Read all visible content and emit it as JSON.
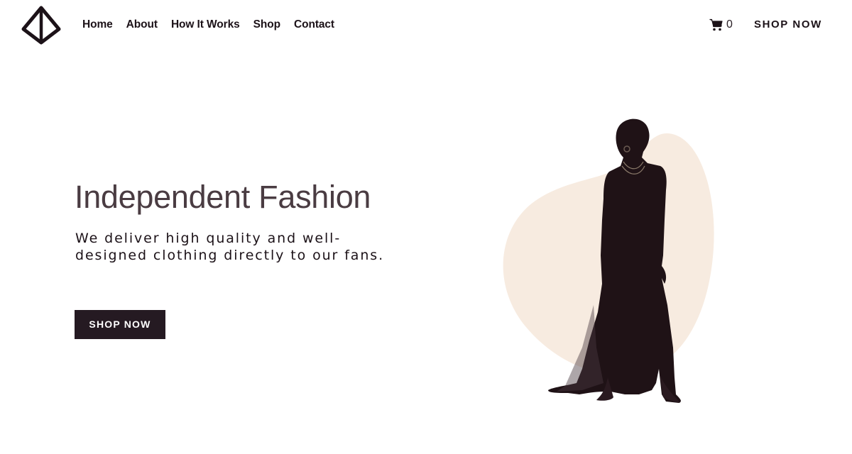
{
  "brand": {
    "logo_icon": "diamond-pyramid-logo-icon",
    "color": "#1c1218"
  },
  "nav": {
    "items": [
      {
        "label": "Home"
      },
      {
        "label": "About"
      },
      {
        "label": "How It Works"
      },
      {
        "label": "Shop"
      },
      {
        "label": "Contact"
      }
    ]
  },
  "header": {
    "cart_icon": "shopping-cart-icon",
    "cart_count": "0",
    "shop_now_label": "SHOP NOW"
  },
  "hero": {
    "title": "Independent Fashion",
    "subtitle": "We deliver high quality and well-designed clothing directly to our fans.",
    "cta_label": "SHOP NOW",
    "accent_blob_color": "#f7ebe0",
    "button_color": "#251a22"
  }
}
